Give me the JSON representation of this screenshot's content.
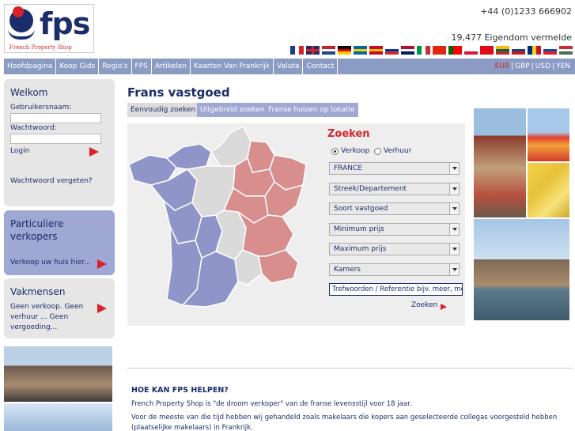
{
  "header": {
    "logo_text": "fps",
    "logo_tagline": "French Property Shop",
    "phone": "+44 (0)1233 666902",
    "listing_count": "19,477 Eigendom vermelde"
  },
  "flags": [
    {
      "name": "flag-fr-icon",
      "colors": [
        "#1f3a93",
        "#ffffff",
        "#d6242a"
      ],
      "dir": "v"
    },
    {
      "name": "flag-uk-icon",
      "colors": [
        "#1b2e6b",
        "#ffffff",
        "#d6242a"
      ],
      "dir": "uk"
    },
    {
      "name": "flag-nl-icon",
      "colors": [
        "#c8202a",
        "#ffffff",
        "#21468b"
      ],
      "dir": "h"
    },
    {
      "name": "flag-de-icon",
      "colors": [
        "#000000",
        "#dd0000",
        "#ffce00"
      ],
      "dir": "h"
    },
    {
      "name": "flag-se-icon",
      "colors": [
        "#006aa7",
        "#fecc00",
        "#006aa7"
      ],
      "dir": "h"
    },
    {
      "name": "flag-es-icon",
      "colors": [
        "#c60b1e",
        "#ffc400",
        "#c60b1e"
      ],
      "dir": "h"
    },
    {
      "name": "flag-ru-icon",
      "colors": [
        "#ffffff",
        "#0039a6",
        "#d52b1e"
      ],
      "dir": "h"
    },
    {
      "name": "flag-no-icon",
      "colors": [
        "#ba0c2f",
        "#ffffff",
        "#00205b"
      ],
      "dir": "h"
    },
    {
      "name": "flag-it-icon",
      "colors": [
        "#009246",
        "#ffffff",
        "#ce2b37"
      ],
      "dir": "v"
    },
    {
      "name": "flag-cn-icon",
      "colors": [
        "#de2910",
        "#de2910",
        "#de2910"
      ],
      "dir": "h"
    },
    {
      "name": "flag-pt-icon",
      "colors": [
        "#006600",
        "#ff0000",
        "#ff0000"
      ],
      "dir": "v"
    },
    {
      "name": "flag-pl-icon",
      "colors": [
        "#ffffff",
        "#ffffff",
        "#dc143c"
      ],
      "dir": "h"
    },
    {
      "name": "flag-tr-icon",
      "colors": [
        "#e30a17",
        "#e30a17",
        "#e30a17"
      ],
      "dir": "h"
    },
    {
      "name": "flag-lt-icon",
      "colors": [
        "#fdb913",
        "#006a44",
        "#c1272d"
      ],
      "dir": "h"
    },
    {
      "name": "flag-cz-icon",
      "colors": [
        "#ffffff",
        "#11457e",
        "#d7141a"
      ],
      "dir": "h"
    },
    {
      "name": "flag-ro-icon",
      "colors": [
        "#002b7f",
        "#fcd116",
        "#ce1126"
      ],
      "dir": "v"
    },
    {
      "name": "flag-sk-icon",
      "colors": [
        "#ffffff",
        "#0b4ea2",
        "#ee1c25"
      ],
      "dir": "h"
    },
    {
      "name": "flag-hu-icon",
      "colors": [
        "#ce2939",
        "#ffffff",
        "#477050"
      ],
      "dir": "h"
    }
  ],
  "nav": {
    "items": [
      "Hoofdpagina",
      "Koop Gids",
      "Regio's",
      "FPS",
      "Artikelen",
      "Kaarten Van Frankrijk",
      "Valuta",
      "Contact"
    ],
    "currencies": [
      "EUR",
      "GBP",
      "USD",
      "YEN"
    ],
    "active_currency": "EUR"
  },
  "login": {
    "title": "Welkom",
    "username_label": "Gebruikersnaam:",
    "password_label": "Wachtwoord:",
    "login_label": "Login",
    "forgot_label": "Wachtwoord vergeten?"
  },
  "sellers": {
    "title_line1": "Particuliere",
    "title_line2": "verkopers",
    "link": "Verkoop uw huis hier..."
  },
  "pros": {
    "title": "Vakmensen",
    "line1": "Geen verkoop. Geen",
    "line2": "verhuur ... Geen",
    "line3": "vergoeding..."
  },
  "main": {
    "title": "Frans vastgoed",
    "tabs": [
      "Eenvoudig zoeken",
      "Uitgebreid zoeken",
      "Franse huizen op lokatie"
    ]
  },
  "search": {
    "title": "Zoeken",
    "radio_buy": "Verkoop",
    "radio_rent": "Verhuur",
    "selected_radio": "Verkoop",
    "selects": [
      "FRANCE",
      "Streek/Departement",
      "Soort vastgoed",
      "Minimum prijs",
      "Maximum prijs",
      "Kamers"
    ],
    "keyword_placeholder": "Trefwoorden / Referentie bijv. meer, mol",
    "submit_label": "Zoeken"
  },
  "help": {
    "title": "HOE KAN FPS HELPEN?",
    "p1": "French Property Shop is \"de droom verkoper\" van de franse levensstijl voor 18 jaar.",
    "p2": "Voor de meeste van die tijd hebben wij gehandeld zoals makelaars die kopers aan geselecteerde collegas voorgesteld hebben",
    "p3": "(plaatselijke makelaars) in Frankrijk."
  },
  "colors": {
    "brand_blue": "#1b2e6b",
    "accent_red": "#d6242a",
    "nav_bg": "#8a9bc4",
    "map_west": "#8f95c8",
    "map_east": "#d98e8e",
    "map_center": "#dadada"
  }
}
